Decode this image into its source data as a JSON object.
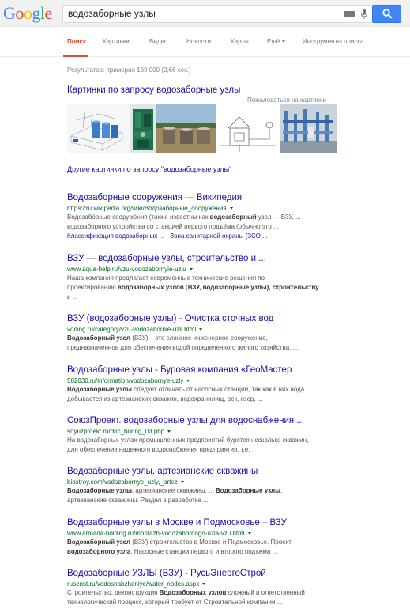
{
  "header": {
    "logo_letters": [
      {
        "ch": "G",
        "color": "#4285f4"
      },
      {
        "ch": "o",
        "color": "#ea4335"
      },
      {
        "ch": "o",
        "color": "#fbbc05"
      },
      {
        "ch": "g",
        "color": "#4285f4"
      },
      {
        "ch": "l",
        "color": "#34a853"
      },
      {
        "ch": "e",
        "color": "#ea4335"
      }
    ],
    "search_value": "водозаборные узлы",
    "icons": {
      "keyboard": "keyboard-icon",
      "mic": "microphone-icon",
      "search": "magnifier-icon"
    }
  },
  "nav": {
    "items": [
      "Поиск",
      "Картинки",
      "Видео",
      "Новости",
      "Карты",
      "Ещё",
      "Инструменты поиска"
    ],
    "active_color": "#dd4b39"
  },
  "stats": "Результатов: примерно 169 000 (0,66 сек.)",
  "images": {
    "heading": "Картинки по запросу водозаборные узлы",
    "complain": "Пожаловаться на картинки",
    "more": "Другие картинки по запросу \"водозаборные узлы\""
  },
  "results": [
    {
      "title": "Водозаборные сооружения — Википедия",
      "url": "https://ru.wikipedia.org/wiki/Водозаборные_сооружения",
      "snippet": [
        "Водозабо́рные сооруже́ния (также известны как водозаборный узел — ВЗУ, ...",
        "водозаборного устройства со станцией первого подъёма (обычно это ..."
      ],
      "links": "Классификация водозаборных ... · Зона санитарной охраны (ЗСО ..."
    },
    {
      "title": "ВЗУ — водозаборные узлы, строительство и ...",
      "url": "www.aqua-help.ru/vzu-vodozabornyie-uzlu",
      "snippet": [
        "Наша компания предлагает современные технические решения по",
        "проектированию водозаборных узлов (ВЗУ, водозаборные узлы), строительству",
        "и ..."
      ]
    },
    {
      "title": "ВЗУ (водозаборные узлы) - Очистка сточных вод",
      "url": "voding.ru/category/vzu-vodozabornie-uzli.html",
      "snippet": [
        "Водозаборный узел (ВЗУ) – это сложное инженерное сооружение,",
        "предназначенное для обеспечения водой определенного жилого хозяйства, ..."
      ]
    },
    {
      "title": "Водозаборные узлы - Буровая компания «ГеоМастер",
      "url": "502030.ru/information/vodozabornye-uzly",
      "snippet": [
        "Водозаборные узлы следует отличать от насосных станций, так как в них вода",
        "добывается из артезианских скважин, водохранилищ, рек, озер, ..."
      ]
    },
    {
      "title": "СоюзПроект. водозаборные узлы для водоснабжения ...",
      "url": "soyuzproekt.ru/doc_boring_03.php",
      "snippet": [
        "На водозаборных узлах промышленных предприятий бурятся несколько скважин,",
        "для обеспечения надежного водоснабжения предприятия, т.е."
      ]
    },
    {
      "title": "Водозаборные узлы, артезианские скважины",
      "url": "biostroy.com/vodozabornye_uzly,_artez",
      "snippet": [
        "Водозаборные узлы, артезианские скважины. ... Водозаборные узлы,",
        "артезианские скважины. Раздел в разработке ..."
      ]
    },
    {
      "title": "Водозаборные узлы в Москве и Подмосковье – ВЗУ",
      "url": "www.armada-holding.ru/montazh-vodozabornogo-uzla-vzu.html",
      "snippet": [
        "Водозаборный узел (ВЗУ) строительство в Москве и Подмосковье. Проект",
        "водозаборного узла. Насосные станции первого и второго подъема ..."
      ]
    },
    {
      "title": "Водозаборные УЗЛЫ (ВЗУ) - РусьЭнергоСтрой",
      "url": "rusenst.ru/vodosnabzheniye/water_nodes.aspx",
      "snippet": [
        "Строительство, реконструкция Водозаборных узлов сложный и ответственный",
        "технологический процесс, который требует от Строительной компании ..."
      ]
    }
  ]
}
